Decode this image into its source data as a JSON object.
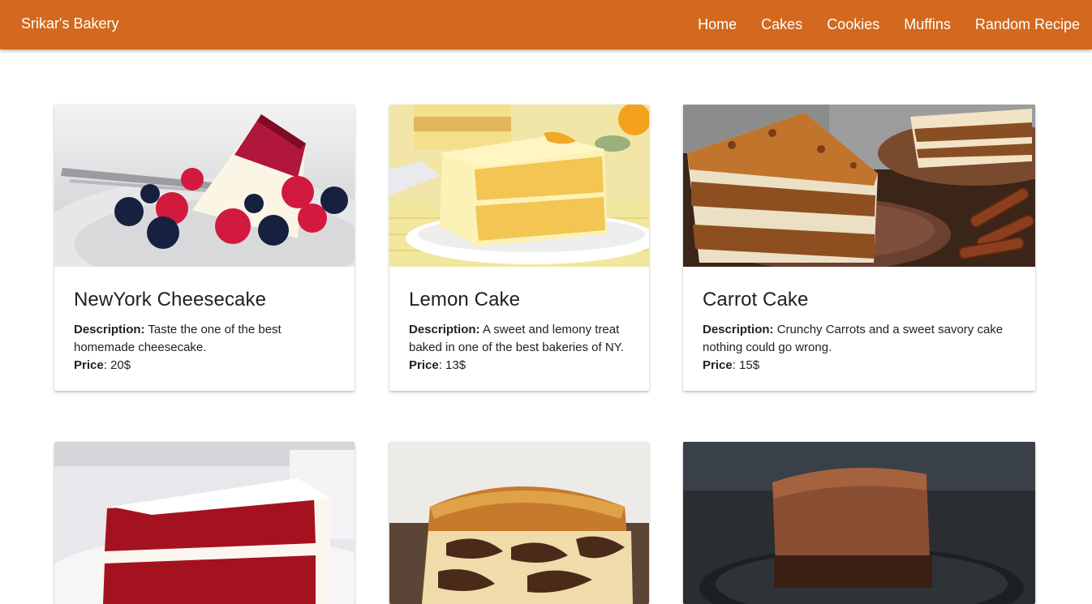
{
  "navbar": {
    "brand": "Srikar's Bakery",
    "links": [
      {
        "label": "Home"
      },
      {
        "label": "Cakes"
      },
      {
        "label": "Cookies"
      },
      {
        "label": "Muffins"
      },
      {
        "label": "Random Recipe"
      }
    ]
  },
  "labels": {
    "description": "Description:",
    "price": "Price"
  },
  "cards": [
    {
      "title": "NewYork Cheesecake",
      "description": "Taste the one of the best homemade cheesecake.",
      "price": "20$",
      "image": "cheesecake-with-berries"
    },
    {
      "title": "Lemon Cake",
      "description": "A sweet and lemony treat baked in one of the best bakeries of NY.",
      "price": "13$",
      "image": "lemon-cake-slice"
    },
    {
      "title": "Carrot Cake",
      "description": "Crunchy Carrots and a sweet savory cake nothing could go wrong.",
      "price": "15$",
      "image": "carrot-cake-slice"
    },
    {
      "image": "red-velvet-cake-slice"
    },
    {
      "image": "marble-pound-cake"
    },
    {
      "image": "chocolate-mousse-cake"
    }
  ]
}
